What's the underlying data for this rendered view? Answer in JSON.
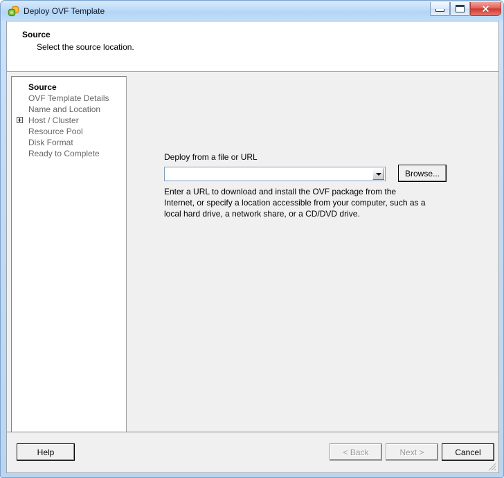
{
  "window": {
    "title": "Deploy OVF Template",
    "icon": "ovf-template-icon",
    "controls": {
      "minimize": "minimize-button",
      "maximize": "maximize-button",
      "close": "✕"
    },
    "colors": {
      "titlebar": "#bcdaf8",
      "frame": "#c4daf2",
      "close_button": "#cf3b32",
      "client_background": "#f0f0f0",
      "panel_background": "#ffffff"
    }
  },
  "header": {
    "title": "Source",
    "subtitle": "Select the source location."
  },
  "sidebar": {
    "items": [
      {
        "label": "Source",
        "active": true,
        "expandable": false
      },
      {
        "label": "OVF Template Details",
        "active": false,
        "expandable": false
      },
      {
        "label": "Name and Location",
        "active": false,
        "expandable": false
      },
      {
        "label": "Host / Cluster",
        "active": false,
        "expandable": true
      },
      {
        "label": "Resource Pool",
        "active": false,
        "expandable": false
      },
      {
        "label": "Disk Format",
        "active": false,
        "expandable": false
      },
      {
        "label": "Ready to Complete",
        "active": false,
        "expandable": false
      }
    ]
  },
  "content": {
    "field_label": "Deploy from a file or URL",
    "source_value": "",
    "source_placeholder": "",
    "browse_label": "Browse...",
    "description": "Enter a URL to download and install the OVF package from the Internet, or specify a location accessible from your computer, such as a local hard drive, a network share, or a CD/DVD drive."
  },
  "footer": {
    "help_label": "Help",
    "back_label": "< Back",
    "next_label": "Next >",
    "cancel_label": "Cancel",
    "back_enabled": false,
    "next_enabled": false
  }
}
